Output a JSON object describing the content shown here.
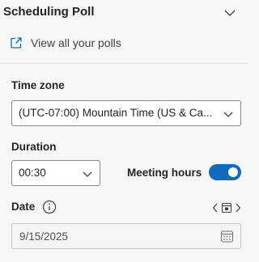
{
  "header": {
    "title": "Scheduling Poll",
    "collapse_icon": "chevron-down-icon"
  },
  "link": {
    "label": "View all your polls",
    "icon": "open-in-new-icon"
  },
  "timezone": {
    "label": "Time zone",
    "value": "(UTC-07:00) Mountain Time (US & Ca..."
  },
  "duration": {
    "label": "Duration",
    "value": "00:30"
  },
  "meeting_hours": {
    "label": "Meeting hours",
    "enabled": true
  },
  "date": {
    "label": "Date",
    "value": "9/15/2025"
  },
  "colors": {
    "accent": "#0f6cbd",
    "background": "#f7f7f7"
  }
}
